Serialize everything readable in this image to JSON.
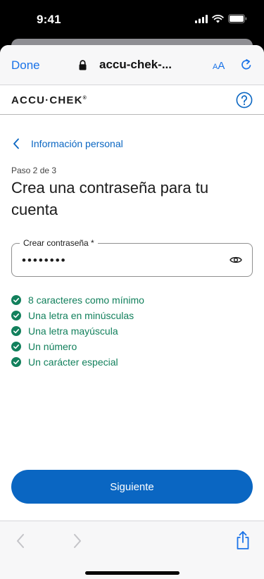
{
  "status_bar": {
    "time": "9:41"
  },
  "safari": {
    "done_label": "Done",
    "url": "accu-chek-...",
    "text_size_small": "A",
    "text_size_large": "A"
  },
  "site": {
    "brand": "ACCU·CHEK",
    "brand_mark": "®"
  },
  "page": {
    "back_link": "Información personal",
    "step": "Paso 2 de 3",
    "title": "Crea una contraseña para tu cuenta",
    "password_label": "Crear contraseña *",
    "password_value": "••••••••",
    "requirements": [
      "8 caracteres como mínimo",
      "Una letra en minúsculas",
      "Una letra mayúscula",
      "Un número",
      "Un carácter especial"
    ],
    "next_label": "Siguiente"
  },
  "colors": {
    "accent": "#0a66c2",
    "ios_blue": "#1a73e8",
    "success": "#12805c"
  }
}
